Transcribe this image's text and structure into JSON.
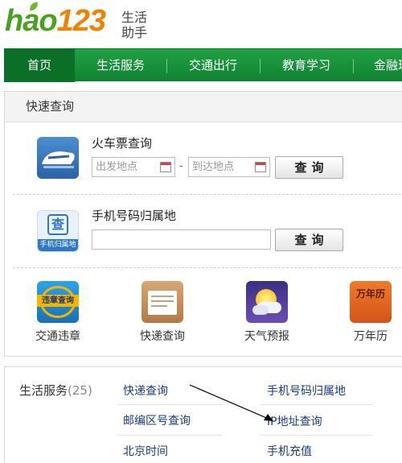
{
  "logo": {
    "word_hao": "hao",
    "word_num": "123",
    "sub_line1": "生活",
    "sub_line2": "助手"
  },
  "nav": [
    "首页",
    "生活服务",
    "交通出行",
    "教育学习",
    "金融理"
  ],
  "quick": {
    "title": "快速查询",
    "train": {
      "title": "火车票查询",
      "from_placeholder": "出发地点",
      "to_placeholder": "到达地点",
      "separator": "-",
      "button": "查询",
      "icon_text": ""
    },
    "phone": {
      "title": "手机号码归属地",
      "button": "查询",
      "icon_caption": "手机归属地",
      "icon_glyph": "查"
    },
    "tiles": [
      {
        "label": "交通违章",
        "icon": "traffic-violation-icon",
        "badge": "违章查询"
      },
      {
        "label": "快递查询",
        "icon": "express-package-icon",
        "badge": ""
      },
      {
        "label": "天气预报",
        "icon": "weather-icon",
        "badge": ""
      },
      {
        "label": "万年历",
        "icon": "calendar-icon",
        "badge": "万年历"
      }
    ]
  },
  "services": {
    "title": "生活服务",
    "count": "(25)",
    "links": [
      "快递查询",
      "手机号码归属地",
      "邮编区号查询",
      "IP地址查询",
      "北京时间",
      "手机充值"
    ]
  },
  "colors": {
    "brand_green": "#1c9a40",
    "brand_orange": "#f08200",
    "link": "#1a3b8a"
  }
}
